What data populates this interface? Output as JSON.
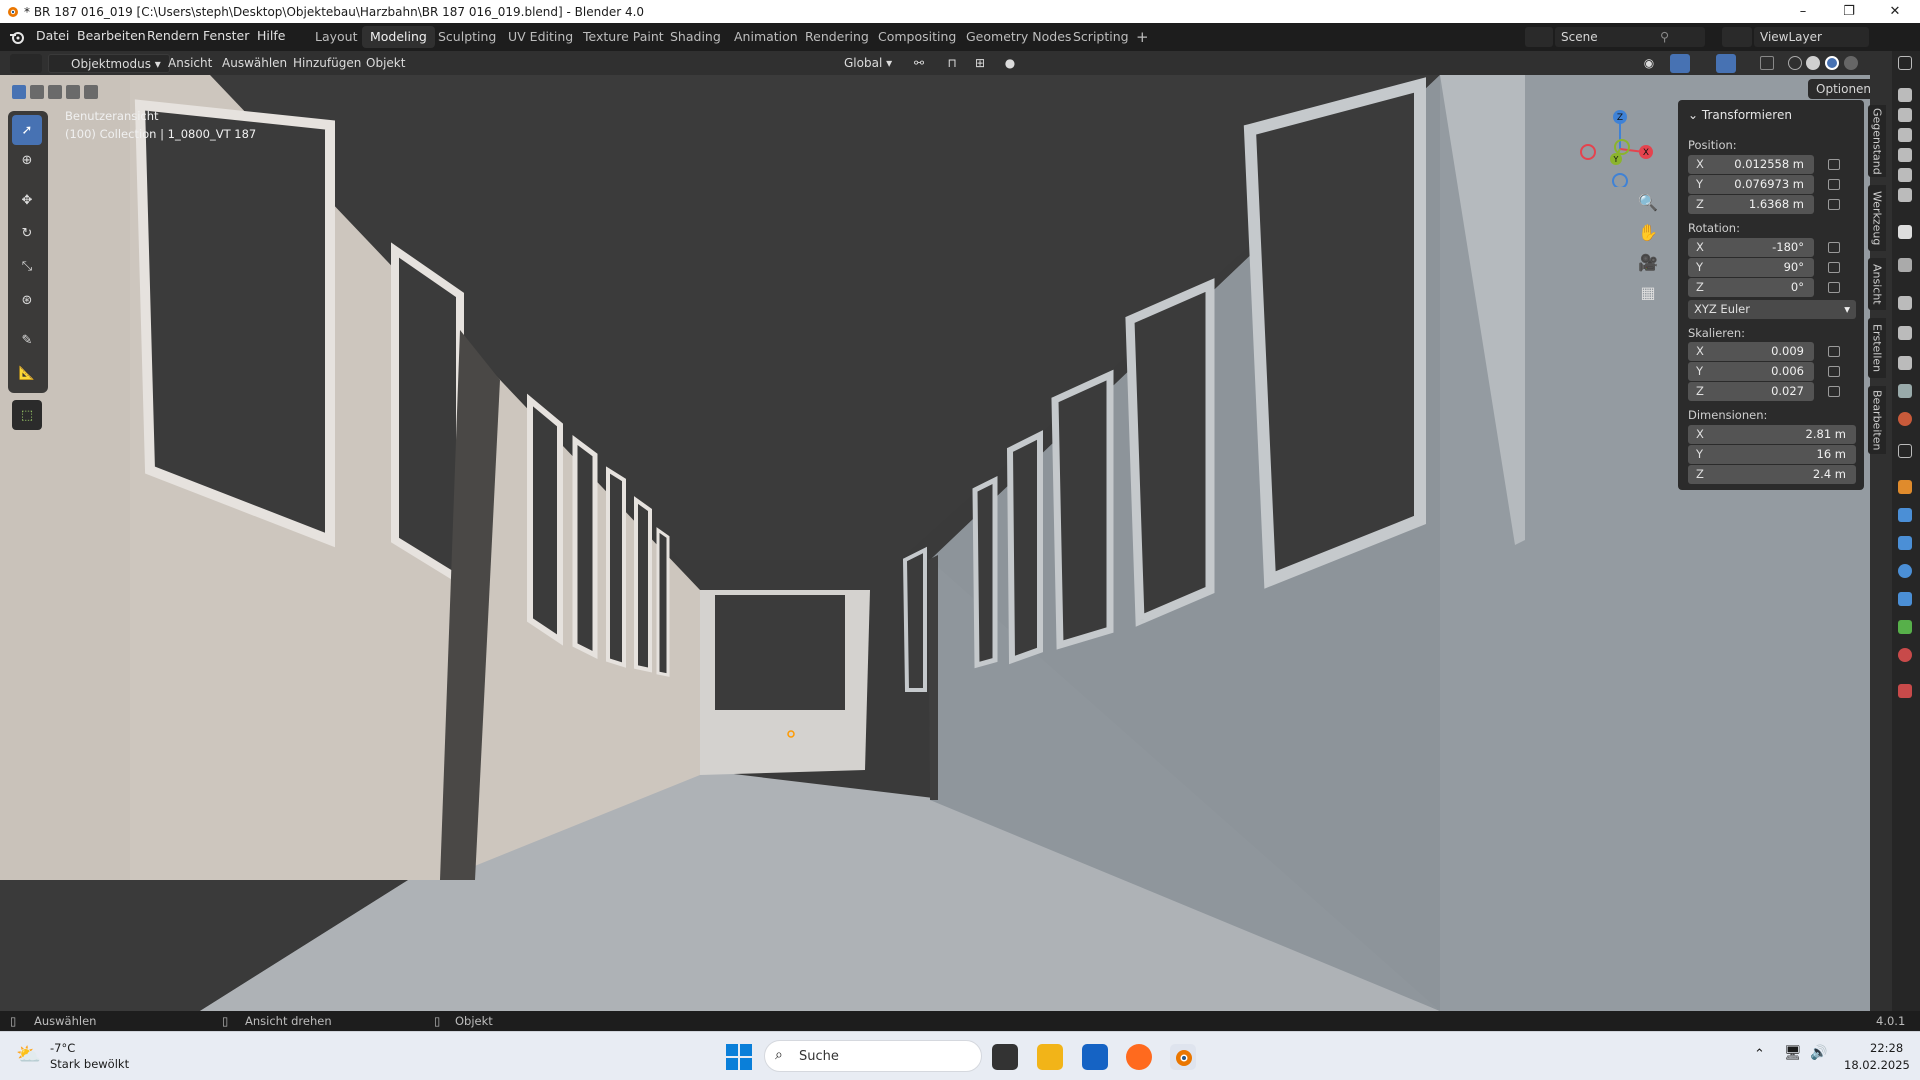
{
  "window": {
    "title": "* BR 187 016_019 [C:\\Users\\steph\\Desktop\\Objektebau\\Harzbahn\\BR 187 016_019.blend] - Blender 4.0",
    "minimize": "–",
    "maximize": "❐",
    "close": "✕"
  },
  "menu": [
    "Datei",
    "Bearbeiten",
    "Rendern",
    "Fenster",
    "Hilfe"
  ],
  "workspaces": [
    {
      "label": "Layout",
      "active": false
    },
    {
      "label": "Modeling",
      "active": true
    },
    {
      "label": "Sculpting",
      "active": false
    },
    {
      "label": "UV Editing",
      "active": false
    },
    {
      "label": "Texture Paint",
      "active": false
    },
    {
      "label": "Shading",
      "active": false
    },
    {
      "label": "Animation",
      "active": false
    },
    {
      "label": "Rendering",
      "active": false
    },
    {
      "label": "Compositing",
      "active": false
    },
    {
      "label": "Geometry Nodes",
      "active": false
    },
    {
      "label": "Scripting",
      "active": false
    }
  ],
  "add_workspace": "+",
  "scene": "Scene",
  "view_layer": "ViewLayer",
  "viewport_header": {
    "mode": "Objektmodus",
    "menus": [
      "Ansicht",
      "Auswählen",
      "Hinzufügen",
      "Objekt"
    ],
    "orientation": "Global",
    "options": "Optionen"
  },
  "viewport_overlay": {
    "view_name": "Benutzeransicht",
    "collection_info": "(100) Collection | 1_0800_VT 187"
  },
  "gizmo": {
    "x": "X",
    "y": "Y",
    "z": "Z"
  },
  "transform_panel": {
    "title": "Transformieren",
    "position_label": "Position:",
    "position": [
      {
        "axis": "X",
        "value": "0.012558 m"
      },
      {
        "axis": "Y",
        "value": "0.076973 m"
      },
      {
        "axis": "Z",
        "value": "1.6368 m"
      }
    ],
    "rotation_label": "Rotation:",
    "rotation": [
      {
        "axis": "X",
        "value": "-180°"
      },
      {
        "axis": "Y",
        "value": "90°"
      },
      {
        "axis": "Z",
        "value": "0°"
      }
    ],
    "rotation_mode": "XYZ Euler",
    "scale_label": "Skalieren:",
    "scale": [
      {
        "axis": "X",
        "value": "0.009"
      },
      {
        "axis": "Y",
        "value": "0.006"
      },
      {
        "axis": "Z",
        "value": "0.027"
      }
    ],
    "dimensions_label": "Dimensionen:",
    "dimensions": [
      {
        "axis": "X",
        "value": "2.81 m"
      },
      {
        "axis": "Y",
        "value": "16 m"
      },
      {
        "axis": "Z",
        "value": "2.4 m"
      }
    ]
  },
  "side_tabs": [
    "Gegenstand",
    "Werkzeug",
    "Ansicht",
    "Erstellen",
    "Bearbeiten"
  ],
  "status_bar": {
    "left": "Auswählen",
    "middle": "Ansicht drehen",
    "right": "Objekt",
    "version": "4.0.1"
  },
  "taskbar": {
    "weather_temp": "-7°C",
    "weather_desc": "Stark bewölkt",
    "search_placeholder": "Suche",
    "time": "22:28",
    "date": "18.02.2025"
  },
  "colors": {
    "accent": "#4772b3",
    "axis_x": "#e5434e",
    "axis_y": "#8bb42c",
    "axis_z": "#3f82d6"
  }
}
